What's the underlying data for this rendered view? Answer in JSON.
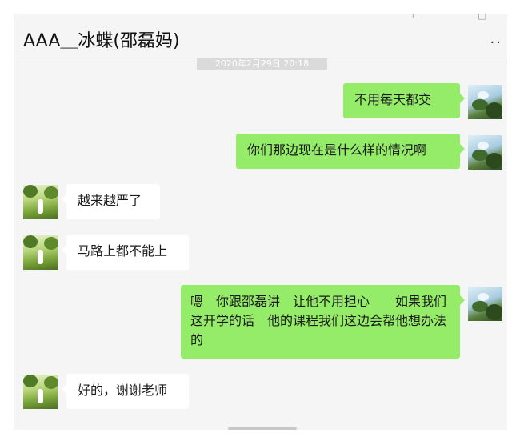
{
  "chat": {
    "title": "AAA＿冰蝶(邵磊妈)",
    "timestamp": "2020年2月29日 20:18"
  },
  "icons": {
    "pin": "pin-icon",
    "maximize": "maximize-icon",
    "more": "more-options-icon"
  },
  "messages": [
    {
      "sender": "me",
      "text": "不用每天都交"
    },
    {
      "sender": "me",
      "text": "你们那边现在是什么样的情况啊"
    },
    {
      "sender": "other",
      "text": "越来越严了"
    },
    {
      "sender": "other",
      "text": "马路上都不能上"
    },
    {
      "sender": "me",
      "text": "嗯　你跟邵磊讲　让他不用担心　　如果我们这开学的话　他的课程我们这边会帮他想办法的"
    },
    {
      "sender": "other",
      "text": "好的，谢谢老师"
    }
  ],
  "colors": {
    "my_bubble": "#95ec69",
    "their_bubble": "#ffffff",
    "chat_background": "#f5f5f5"
  }
}
